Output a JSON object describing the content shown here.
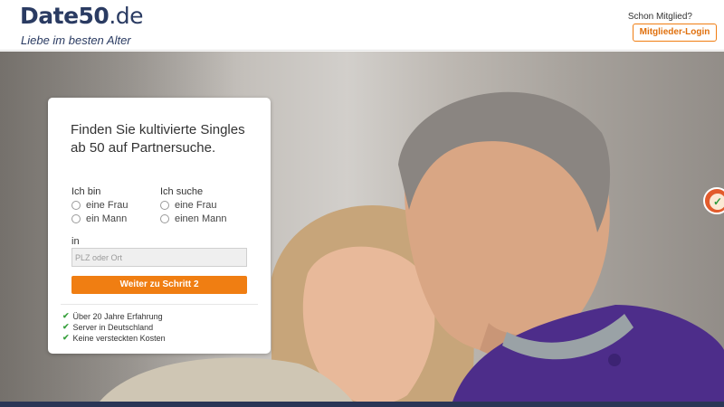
{
  "header": {
    "logo_brand": "Date50",
    "logo_tld": ".de",
    "tagline": "Liebe im besten Alter",
    "member_question": "Schon Mitglied?",
    "login_label": "Mitglieder-Login"
  },
  "form": {
    "title": "Finden Sie kultivierte Singles ab 50 auf Partnersuche.",
    "i_am_label": "Ich bin",
    "i_am_options": [
      "eine Frau",
      "ein Mann"
    ],
    "seeking_label": "Ich suche",
    "seeking_options": [
      "eine Frau",
      "einen Mann"
    ],
    "location_label": "in",
    "location_placeholder": "PLZ oder Ort",
    "submit_label": "Weiter zu Schritt 2"
  },
  "benefits": [
    "Über 20 Jahre Erfahrung",
    "Server in Deutschland",
    "Keine versteckten Kosten"
  ],
  "colors": {
    "brand_navy": "#2a3b62",
    "accent_orange": "#f07e12",
    "check_green": "#3aa13f"
  },
  "icons": {
    "check": "check-icon",
    "badge": "seal-badge-icon"
  }
}
